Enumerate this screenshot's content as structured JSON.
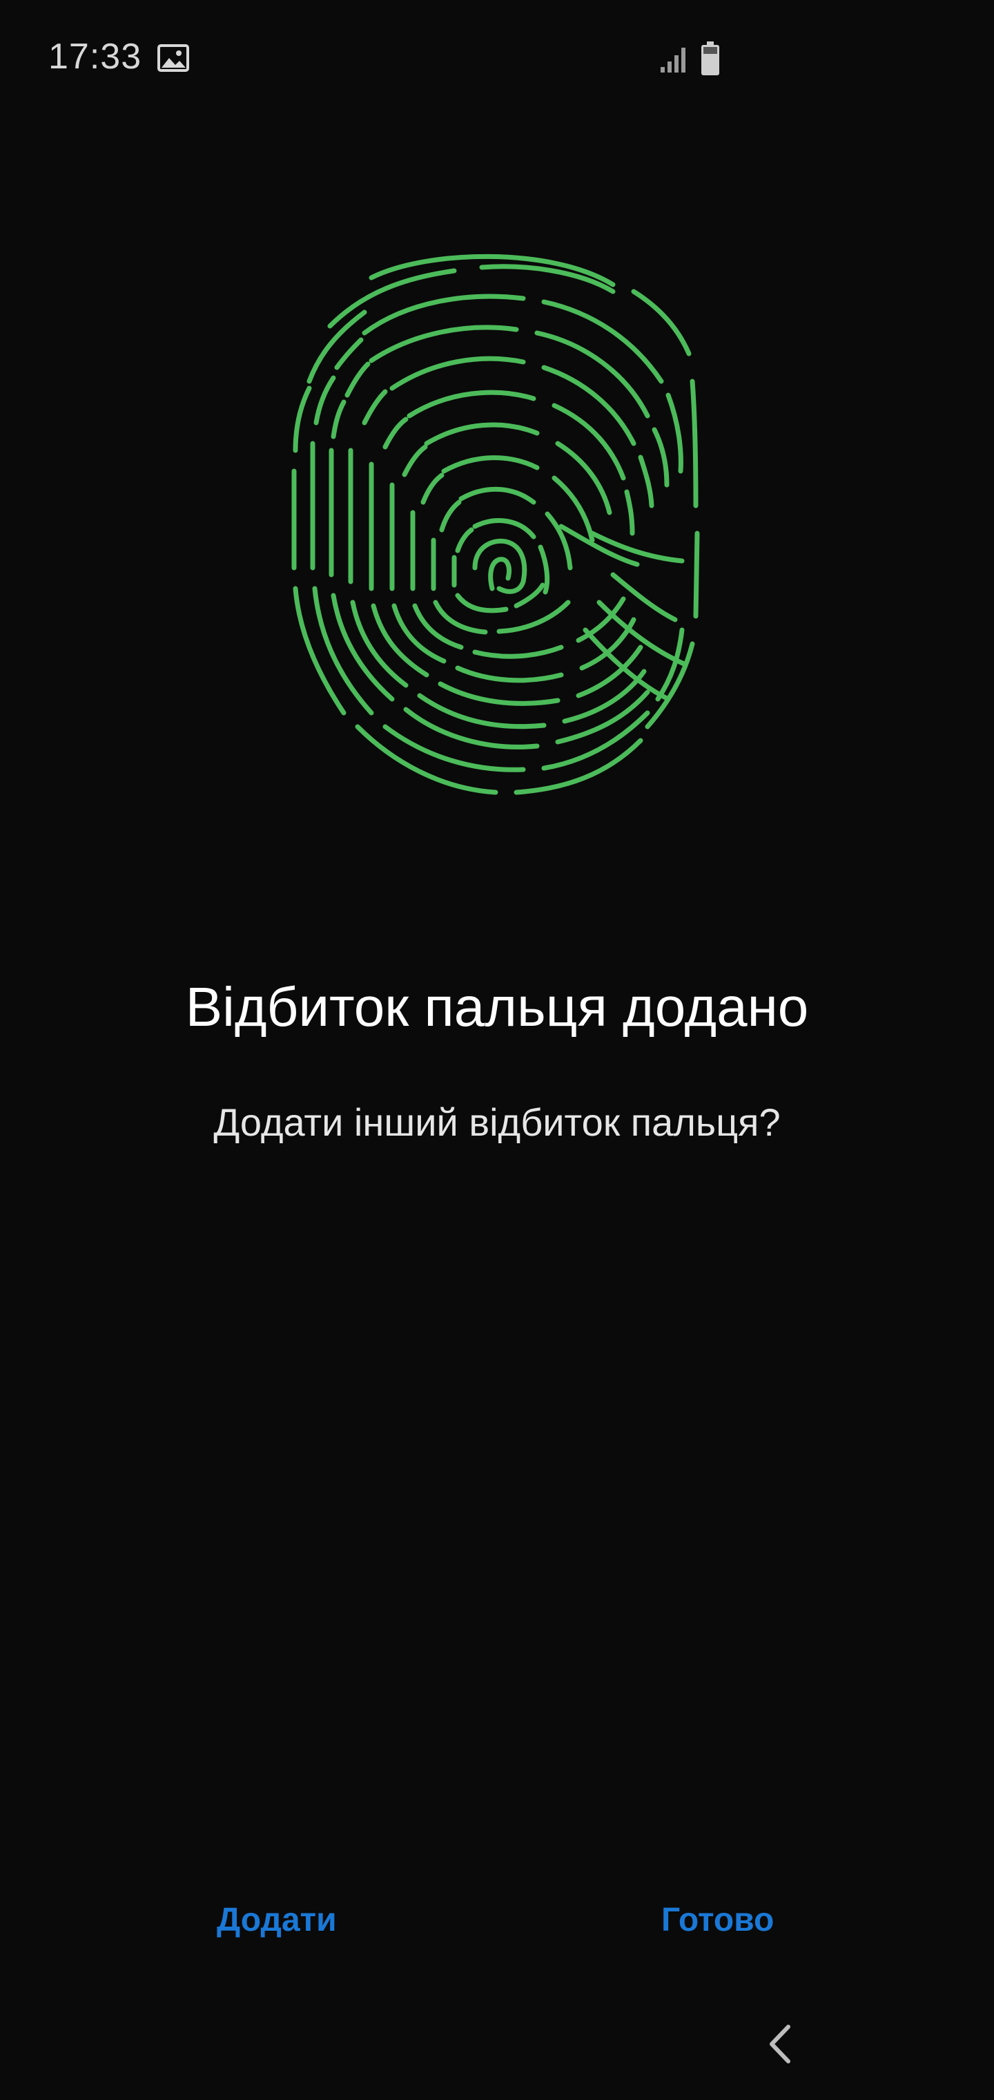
{
  "status_bar": {
    "time": "17:33",
    "icons": [
      "gallery-icon",
      "signal-icon",
      "battery-icon"
    ]
  },
  "fingerprint": {
    "icon": "fingerprint-icon",
    "color": "#4cbb5a"
  },
  "content": {
    "title": "Відбиток пальця додано",
    "subtitle": "Додати інший відбиток пальця?"
  },
  "actions": {
    "add_label": "Додати",
    "done_label": "Готово",
    "accent_color": "#1a78d6"
  },
  "nav": {
    "back_icon": "chevron-left-icon"
  }
}
